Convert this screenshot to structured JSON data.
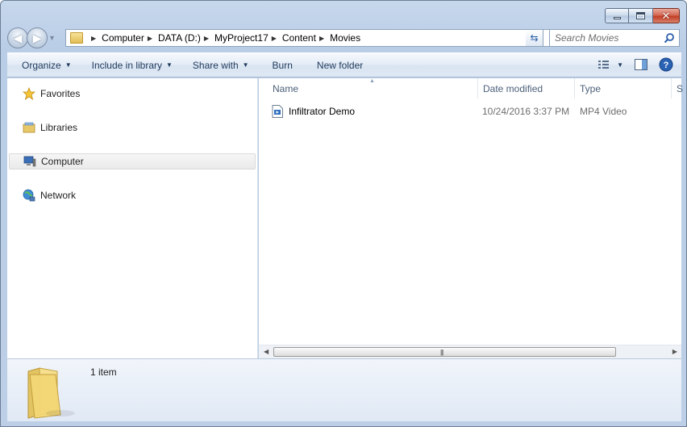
{
  "window": {
    "controls": {
      "minimize": "minimize",
      "maximize": "maximize",
      "close": "close"
    }
  },
  "nav": {
    "breadcrumbs": [
      "Computer",
      "DATA (D:)",
      "MyProject17",
      "Content",
      "Movies"
    ],
    "search_placeholder": "Search Movies"
  },
  "toolbar": {
    "organize": "Organize",
    "include_in_library": "Include in library",
    "share_with": "Share with",
    "burn": "Burn",
    "new_folder": "New folder"
  },
  "sidebar": {
    "items": [
      {
        "label": "Favorites",
        "icon": "star-icon"
      },
      {
        "label": "Libraries",
        "icon": "libraries-icon"
      },
      {
        "label": "Computer",
        "icon": "computer-icon",
        "selected": true
      },
      {
        "label": "Network",
        "icon": "network-icon"
      }
    ]
  },
  "columns": {
    "name": "Name",
    "date_modified": "Date modified",
    "type": "Type",
    "size": "S"
  },
  "files": [
    {
      "name": "Infiltrator Demo",
      "date_modified": "10/24/2016 3:37 PM",
      "type": "MP4 Video",
      "icon": "video-file-icon"
    }
  ],
  "details": {
    "item_count": "1 item"
  },
  "colors": {
    "frame": "#bccfe6",
    "command_text": "#1e395b",
    "header_text": "#4c607a",
    "secondary_text": "#6d6d6d",
    "close_button": "#c23e25"
  }
}
